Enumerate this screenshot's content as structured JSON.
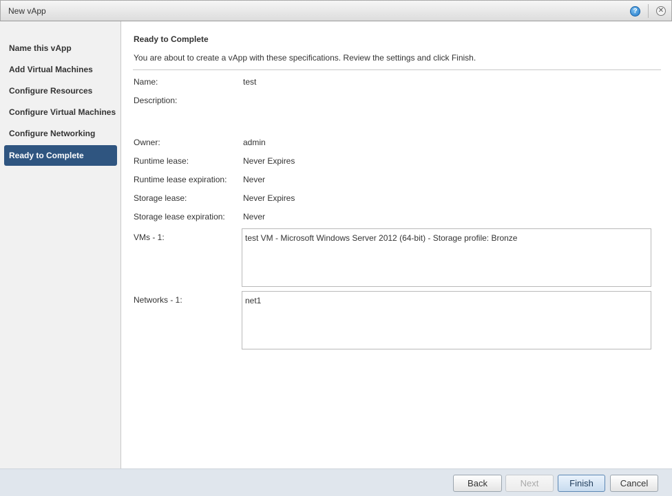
{
  "window": {
    "title": "New vApp"
  },
  "sidebar": {
    "items": [
      {
        "label": "Name this vApp"
      },
      {
        "label": "Add Virtual Machines"
      },
      {
        "label": "Configure Resources"
      },
      {
        "label": "Configure Virtual Machines"
      },
      {
        "label": "Configure Networking"
      },
      {
        "label": "Ready to Complete",
        "active": true
      }
    ]
  },
  "main": {
    "title": "Ready to Complete",
    "intro": "You are about to create a vApp with these specifications. Review the settings and click Finish.",
    "fields": {
      "name": {
        "label": "Name:",
        "value": "test"
      },
      "description": {
        "label": "Description:",
        "value": ""
      },
      "owner": {
        "label": "Owner:",
        "value": "admin"
      },
      "runtime_lease": {
        "label": "Runtime lease:",
        "value": "Never Expires"
      },
      "runtime_lease_expiration": {
        "label": "Runtime lease expiration:",
        "value": "Never"
      },
      "storage_lease": {
        "label": "Storage lease:",
        "value": "Never Expires"
      },
      "storage_lease_expiration": {
        "label": "Storage lease expiration:",
        "value": "Never"
      },
      "vms": {
        "label": "VMs - 1:",
        "value": "test VM - Microsoft Windows Server 2012 (64-bit) - Storage profile: Bronze"
      },
      "networks": {
        "label": "Networks - 1:",
        "value": "net1"
      }
    }
  },
  "footer": {
    "back_label": "Back",
    "next_label": "Next",
    "finish_label": "Finish",
    "cancel_label": "Cancel"
  },
  "colors": {
    "active_nav": "#2f5580",
    "footer_bg": "#e0e6ed",
    "sidebar_bg": "#f1f1f1"
  }
}
